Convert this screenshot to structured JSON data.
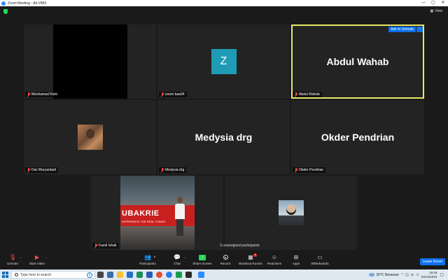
{
  "window": {
    "title": "Zoom Meeting - Alt-V863",
    "controls": {
      "minimize": "—",
      "maximize": "▢",
      "close": "✕"
    }
  },
  "topbar": {
    "view_label": "View"
  },
  "tiles": {
    "mochamad": {
      "name": "Mochamad Rizki"
    },
    "zoom_baa04": {
      "name": "zoom baa04",
      "avatar_letter": "Z",
      "avatar_color": "#1f9bb5"
    },
    "abdul": {
      "name": "Abdul Wahab",
      "display_name": "Abdul Wahab",
      "ask_unmute": "Ask to Unmute",
      "more": "···"
    },
    "dwi": {
      "name": "Dwi Wuryantadi"
    },
    "medysia": {
      "name": "Medysia drg",
      "display_name": "Medysia drg"
    },
    "okder": {
      "name": "Okder Pendrian",
      "display_name": "Okder Pendrian"
    },
    "famil": {
      "name": "Famil Ishak",
      "banner_text": "UBAKRIE",
      "banner_sub": "EXPERIENCE THE REAL THINGS"
    },
    "last": {
      "name": ""
    }
  },
  "unassigned_text": "3 unassigned participants",
  "toolbar": {
    "unmute": "Unmute",
    "start_video": "Start Video",
    "participants": "Participants",
    "participants_count": "8",
    "chat": "Chat",
    "share_screen": "Share Screen",
    "record": "Record",
    "breakout_rooms": "Breakout Rooms",
    "breakout_badge": "4",
    "reactions": "Reactions",
    "apps": "Apps",
    "whiteboards": "Whiteboards",
    "leave": "Leave Room"
  },
  "taskbar": {
    "search_placeholder": "Type here to search",
    "weather": "30°C  Berawan",
    "time": "18:49",
    "date": "04/13/2023"
  },
  "colors": {
    "accent": "#0e72ed",
    "active_speaker": "#e8e86a",
    "share_green": "#23d959",
    "badge": "#e02828"
  }
}
